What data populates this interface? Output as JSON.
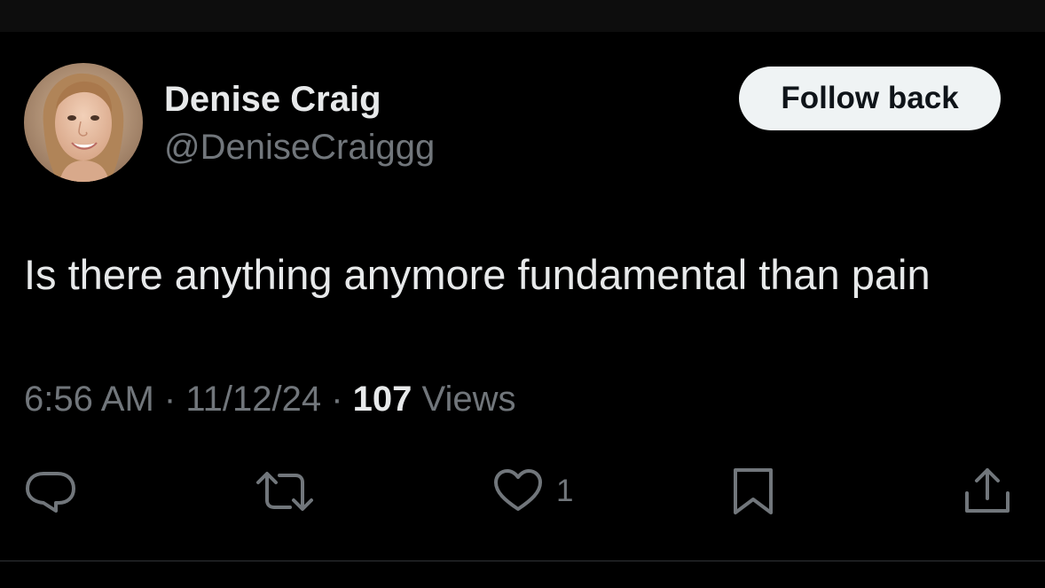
{
  "author": {
    "name": "Denise Craig",
    "handle": "@DeniseCraiggg"
  },
  "follow_button": {
    "label": "Follow back"
  },
  "tweet": {
    "text": "Is there anything anymore fundamental than pain"
  },
  "meta": {
    "time": "6:56 AM",
    "separator": "·",
    "date": "11/12/24",
    "views_count": "107",
    "views_label": "Views"
  },
  "actions": {
    "reply_icon": "speech-bubble-icon",
    "retweet_icon": "retweet-arrows-icon",
    "like_icon": "heart-outline-icon",
    "like_count": "1",
    "bookmark_icon": "bookmark-icon",
    "share_icon": "share-upload-icon"
  },
  "colors": {
    "background": "#000000",
    "primary_text": "#e7e9ea",
    "secondary_text": "#71767b",
    "button_bg": "#eff3f4",
    "button_text": "#0f1419",
    "divider": "#2f3336"
  }
}
